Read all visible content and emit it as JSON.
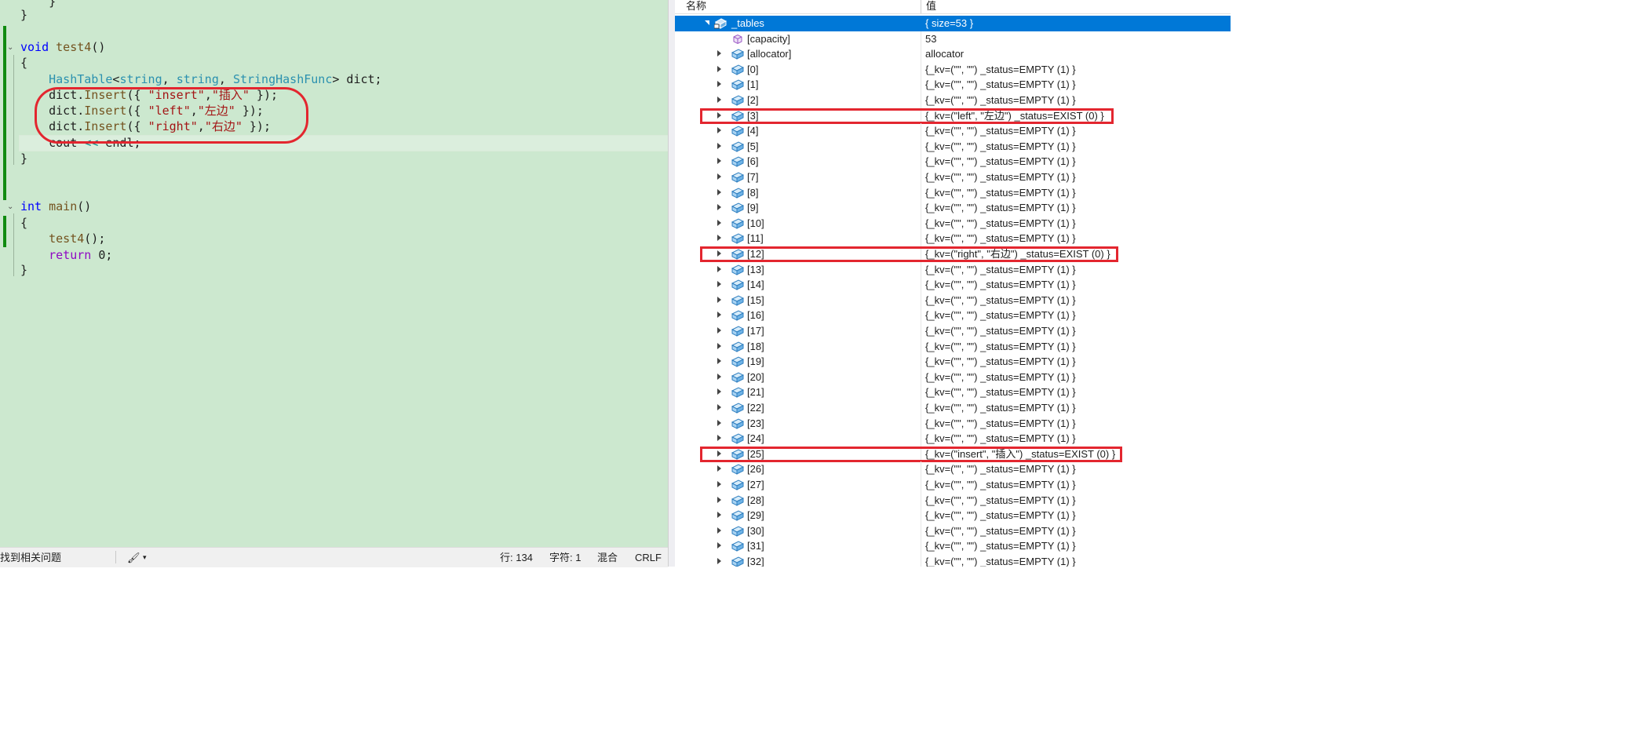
{
  "editor": {
    "lines": {
      "l0": "    }",
      "l1": "}",
      "test4_kw": "void",
      "test4_fn": "test4",
      "test4_paren": "()",
      "open1": "{",
      "decl_type": "HashTable",
      "decl_lt": "<",
      "decl_t1": "string",
      "decl_comma": ", ",
      "decl_t2": "string",
      "decl_comma2": ", ",
      "decl_t3": "StringHashFunc",
      "decl_rest": "> dict;",
      "ins1_pre": "dict.",
      "ins1_fn": "Insert",
      "ins1_open": "({ ",
      "ins1_k": "\"insert\"",
      "ins1_c": ",",
      "ins1_v": "\"插入\"",
      "ins1_close": " });",
      "ins2_pre": "dict.",
      "ins2_fn": "Insert",
      "ins2_open": "({ ",
      "ins2_k": "\"left\"",
      "ins2_c": ",",
      "ins2_v": "\"左边\"",
      "ins2_close": " });",
      "ins3_pre": "dict.",
      "ins3_fn": "Insert",
      "ins3_open": "({ ",
      "ins3_k": "\"right\"",
      "ins3_c": ",",
      "ins3_v": "\"右边\"",
      "ins3_close": " });",
      "cout_a": "cout ",
      "cout_op": "<<",
      "cout_b": " endl;",
      "close1": "}",
      "main_kw": "int",
      "main_fn": " main",
      "main_paren": "()",
      "open2": "{",
      "call_fn": "test4",
      "call_rest": "();",
      "ret_kw": "return",
      "ret_rest": " 0;",
      "close2": "}"
    }
  },
  "statusbar": {
    "issues": "找到相关问题",
    "brush_icon": "🖌",
    "caret": "▾",
    "line": "行: 134",
    "char": "字符: 1",
    "mixed": "混合",
    "eol": "CRLF"
  },
  "watch": {
    "header_name": "名称",
    "header_value": "值",
    "root": {
      "name": "_tables",
      "value": "{ size=53 }"
    },
    "capacity": {
      "name": "[capacity]",
      "value": "53"
    },
    "allocator": {
      "name": "[allocator]",
      "value": "allocator"
    },
    "rows": [
      {
        "name": "[0]",
        "value": "{_kv=(\"\", \"\") _status=EMPTY (1) }"
      },
      {
        "name": "[1]",
        "value": "{_kv=(\"\", \"\") _status=EMPTY (1) }"
      },
      {
        "name": "[2]",
        "value": "{_kv=(\"\", \"\") _status=EMPTY (1) }"
      },
      {
        "name": "[3]",
        "value": "{_kv=(\"left\", \"左边\") _status=EXIST (0) }"
      },
      {
        "name": "[4]",
        "value": "{_kv=(\"\", \"\") _status=EMPTY (1) }"
      },
      {
        "name": "[5]",
        "value": "{_kv=(\"\", \"\") _status=EMPTY (1) }"
      },
      {
        "name": "[6]",
        "value": "{_kv=(\"\", \"\") _status=EMPTY (1) }"
      },
      {
        "name": "[7]",
        "value": "{_kv=(\"\", \"\") _status=EMPTY (1) }"
      },
      {
        "name": "[8]",
        "value": "{_kv=(\"\", \"\") _status=EMPTY (1) }"
      },
      {
        "name": "[9]",
        "value": "{_kv=(\"\", \"\") _status=EMPTY (1) }"
      },
      {
        "name": "[10]",
        "value": "{_kv=(\"\", \"\") _status=EMPTY (1) }"
      },
      {
        "name": "[11]",
        "value": "{_kv=(\"\", \"\") _status=EMPTY (1) }"
      },
      {
        "name": "[12]",
        "value": "{_kv=(\"right\", \"右边\") _status=EXIST (0) }"
      },
      {
        "name": "[13]",
        "value": "{_kv=(\"\", \"\") _status=EMPTY (1) }"
      },
      {
        "name": "[14]",
        "value": "{_kv=(\"\", \"\") _status=EMPTY (1) }"
      },
      {
        "name": "[15]",
        "value": "{_kv=(\"\", \"\") _status=EMPTY (1) }"
      },
      {
        "name": "[16]",
        "value": "{_kv=(\"\", \"\") _status=EMPTY (1) }"
      },
      {
        "name": "[17]",
        "value": "{_kv=(\"\", \"\") _status=EMPTY (1) }"
      },
      {
        "name": "[18]",
        "value": "{_kv=(\"\", \"\") _status=EMPTY (1) }"
      },
      {
        "name": "[19]",
        "value": "{_kv=(\"\", \"\") _status=EMPTY (1) }"
      },
      {
        "name": "[20]",
        "value": "{_kv=(\"\", \"\") _status=EMPTY (1) }"
      },
      {
        "name": "[21]",
        "value": "{_kv=(\"\", \"\") _status=EMPTY (1) }"
      },
      {
        "name": "[22]",
        "value": "{_kv=(\"\", \"\") _status=EMPTY (1) }"
      },
      {
        "name": "[23]",
        "value": "{_kv=(\"\", \"\") _status=EMPTY (1) }"
      },
      {
        "name": "[24]",
        "value": "{_kv=(\"\", \"\") _status=EMPTY (1) }"
      },
      {
        "name": "[25]",
        "value": "{_kv=(\"insert\", \"插入\") _status=EXIST (0) }"
      },
      {
        "name": "[26]",
        "value": "{_kv=(\"\", \"\") _status=EMPTY (1) }"
      },
      {
        "name": "[27]",
        "value": "{_kv=(\"\", \"\") _status=EMPTY (1) }"
      },
      {
        "name": "[28]",
        "value": "{_kv=(\"\", \"\") _status=EMPTY (1) }"
      },
      {
        "name": "[29]",
        "value": "{_kv=(\"\", \"\") _status=EMPTY (1) }"
      },
      {
        "name": "[30]",
        "value": "{_kv=(\"\", \"\") _status=EMPTY (1) }"
      },
      {
        "name": "[31]",
        "value": "{_kv=(\"\", \"\") _status=EMPTY (1) }"
      },
      {
        "name": "[32]",
        "value": "{_kv=(\"\", \"\") _status=EMPTY (1) }"
      }
    ]
  },
  "colors": {
    "editor_bg": "#cce8cf",
    "selection": "#0078d7",
    "annotation_red": "#e3262f"
  }
}
